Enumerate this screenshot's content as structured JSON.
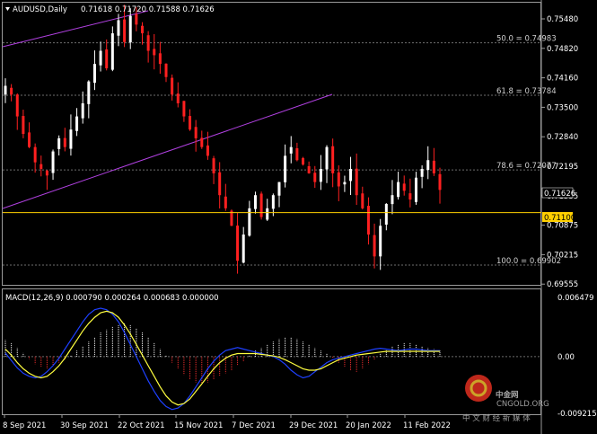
{
  "chart_data": [
    {
      "type": "candlestick",
      "symbol_label": "AUDUSD,Daily",
      "ohlc_label": "0.71618 0.71720 0.71588 0.71626",
      "ylim": [
        0.6945,
        0.759
      ],
      "y_ticks": [
        "0.75480",
        "0.74820",
        "0.74160",
        "0.73500",
        "0.72840",
        "0.72195",
        "0.71535",
        "0.70875",
        "0.70215",
        "0.69555"
      ],
      "x_ticks": [
        "8 Sep 2021",
        "30 Sep 2021",
        "22 Oct 2021",
        "15 Nov 2021",
        "7 Dec 2021",
        "29 Dec 2021",
        "20 Jan 2022",
        "11 Feb 2022"
      ],
      "current_price": "0.71626",
      "horizontal_line": "0.71100",
      "fib_levels": [
        {
          "label": "50.0 = 0.74983",
          "value": 0.74983
        },
        {
          "label": "61.8 = 0.73784",
          "value": 0.73784
        },
        {
          "label": "78.6 = 0.72077",
          "value": 0.72077
        },
        {
          "label": "100.0 = 0.69902",
          "value": 0.69902
        }
      ],
      "close_path": [
        0.74,
        0.738,
        0.733,
        0.729,
        0.726,
        0.7225,
        0.721,
        0.7195,
        0.725,
        0.728,
        0.726,
        0.73,
        0.733,
        0.736,
        0.741,
        0.745,
        0.748,
        0.744,
        0.752,
        0.755,
        0.75,
        0.756,
        0.754,
        0.752,
        0.748,
        0.747,
        0.745,
        0.742,
        0.738,
        0.736,
        0.733,
        0.73,
        0.728,
        0.726,
        0.724,
        0.72,
        0.715,
        0.712,
        0.708,
        0.7,
        0.706,
        0.712,
        0.715,
        0.71,
        0.712,
        0.715,
        0.718,
        0.724,
        0.726,
        0.723,
        0.722,
        0.72,
        0.718,
        0.721,
        0.726,
        0.72,
        0.717,
        0.718,
        0.721,
        0.715,
        0.712,
        0.706,
        0.701,
        0.708,
        0.713,
        0.715,
        0.718,
        0.716,
        0.714,
        0.719,
        0.721,
        0.723,
        0.72,
        0.7162
      ]
    },
    {
      "type": "macd",
      "label": "MACD(12,26,9) 0.000790 0.000264 0.000683 0.000000",
      "ylim": [
        -0.0075,
        0.007
      ],
      "y_ticks": [
        "0.006479",
        "0.00",
        "-0.009215"
      ],
      "histogram": [
        0.0022,
        0.0018,
        0.0012,
        0.0005,
        -0.0003,
        -0.001,
        -0.0014,
        -0.0016,
        -0.0012,
        -0.0008,
        -0.0004,
        0.0002,
        0.0008,
        0.0014,
        0.002,
        0.0026,
        0.0032,
        0.0036,
        0.004,
        0.0042,
        0.0044,
        0.0042,
        0.0038,
        0.0032,
        0.0026,
        0.0018,
        0.001,
        0.0002,
        -0.0008,
        -0.0016,
        -0.0024,
        -0.003,
        -0.0034,
        -0.0036,
        -0.0034,
        -0.003,
        -0.0026,
        -0.0022,
        -0.0018,
        -0.0012,
        -0.0006,
        0.0002,
        0.0008,
        0.0012,
        0.0016,
        0.002,
        0.0024,
        0.0026,
        0.0026,
        0.0024,
        0.002,
        0.0016,
        0.0012,
        0.0008,
        0.0004,
        -0.0002,
        -0.0008,
        -0.0014,
        -0.0018,
        -0.002,
        -0.0016,
        -0.001,
        -0.0004,
        0.0004,
        0.001,
        0.0014,
        0.0016,
        0.0018,
        0.0018,
        0.0016,
        0.0014,
        0.0012,
        0.001,
        0.0008
      ],
      "macd_line": [
        0.0005,
        -0.0005,
        -0.0015,
        -0.0022,
        -0.0026,
        -0.0028,
        -0.0026,
        -0.002,
        -0.0012,
        -0.0002,
        0.001,
        0.0022,
        0.0034,
        0.0046,
        0.0056,
        0.0062,
        0.0064,
        0.0062,
        0.0056,
        0.0046,
        0.0032,
        0.0016,
        0.0,
        -0.0016,
        -0.0032,
        -0.0046,
        -0.0058,
        -0.0066,
        -0.007,
        -0.0068,
        -0.0062,
        -0.0052,
        -0.004,
        -0.0028,
        -0.0016,
        -0.0006,
        0.0002,
        0.0008,
        0.001,
        0.0012,
        0.001,
        0.0008,
        0.0006,
        0.0004,
        0.0002,
        0.0,
        -0.0004,
        -0.001,
        -0.0018,
        -0.0024,
        -0.0028,
        -0.0026,
        -0.002,
        -0.0014,
        -0.0008,
        -0.0004,
        -0.0002,
        0.0,
        0.0002,
        0.0004,
        0.0006,
        0.0008,
        0.001,
        0.0011,
        0.001,
        0.0009,
        0.0008,
        0.0009,
        0.001,
        0.001,
        0.0009,
        0.0008,
        0.0008,
        0.0008
      ],
      "signal_line": [
        0.001,
        0.0002,
        -0.0008,
        -0.0016,
        -0.0022,
        -0.0026,
        -0.0028,
        -0.0026,
        -0.002,
        -0.0012,
        -0.0002,
        0.001,
        0.0022,
        0.0034,
        0.0044,
        0.0052,
        0.0058,
        0.006,
        0.0058,
        0.0052,
        0.0042,
        0.003,
        0.0016,
        0.0002,
        -0.0012,
        -0.0026,
        -0.004,
        -0.0052,
        -0.006,
        -0.0064,
        -0.0062,
        -0.0056,
        -0.0046,
        -0.0036,
        -0.0026,
        -0.0016,
        -0.0008,
        -0.0002,
        0.0002,
        0.0004,
        0.0004,
        0.0004,
        0.0004,
        0.0003,
        0.0002,
        0.0001,
        -0.0001,
        -0.0004,
        -0.0008,
        -0.0012,
        -0.0016,
        -0.0018,
        -0.0018,
        -0.0016,
        -0.0012,
        -0.0008,
        -0.0004,
        -0.0002,
        0.0,
        0.0002,
        0.0003,
        0.0004,
        0.0005,
        0.0006,
        0.0007,
        0.0007,
        0.0007,
        0.0007,
        0.0007,
        0.0007,
        0.0007,
        0.0007,
        0.0007,
        0.0007
      ]
    }
  ],
  "colors": {
    "background": "#000000",
    "grid": "#6e6e6e",
    "bull": "#ffffff",
    "bear": "#ff2020",
    "hline": "#ffd000",
    "channel": "#b040e0",
    "macd": "#1e40ff",
    "signal": "#ffff40",
    "hist_pos": "#ffffff",
    "hist_neg": "#ff3030"
  },
  "watermark": {
    "text": "中金网",
    "site": "CNGOLD.ORG",
    "slogan": "中 文 财 经 新 媒 体"
  }
}
